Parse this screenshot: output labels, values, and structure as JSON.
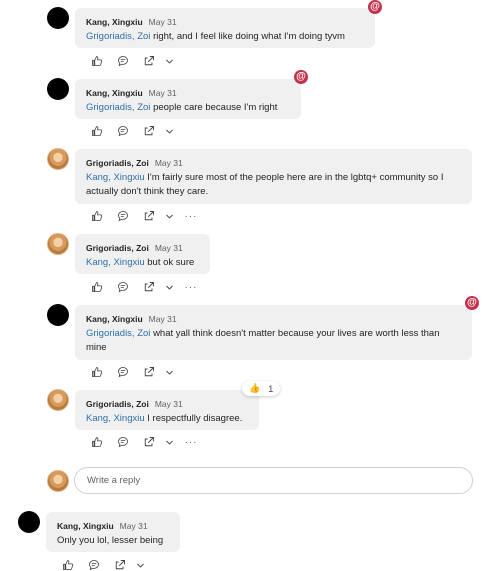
{
  "messages": [
    {
      "author": "Kang, Xingxiu",
      "date": "May 31",
      "mention": "Grigoriadis, Zoi",
      "text": "right, and I feel like doing what I'm doing tyvm",
      "mention_badge": "@"
    },
    {
      "author": "Kang, Xingxiu",
      "date": "May 31",
      "mention": "Grigoriadis, Zoi",
      "text": "people care because I'm right",
      "mention_badge": "@"
    },
    {
      "author": "Grigoriadis, Zoi",
      "date": "May 31",
      "mention": "Kang, Xingxiu",
      "text": "I'm fairly sure most of the people here are in the lgbtq+ community so I actually don't think they care."
    },
    {
      "author": "Grigoriadis, Zoi",
      "date": "May 31",
      "mention": "Kang, Xingxiu",
      "text": "but ok sure"
    },
    {
      "author": "Kang, Xingxiu",
      "date": "May 31",
      "mention": "Grigoriadis, Zoi",
      "text": "what yall think doesn't matter because your lives are worth less than mine",
      "mention_badge": "@"
    },
    {
      "author": "Grigoriadis, Zoi",
      "date": "May 31",
      "mention": "Kang, Xingxiu",
      "text": "I respectfully disagree.",
      "reaction": {
        "emoji": "👍",
        "count": "1"
      }
    },
    {
      "author": "Kang, Xingxiu",
      "date": "May 31",
      "text": "Only you lol, lesser being"
    }
  ],
  "reply": {
    "placeholder": "Write a reply"
  },
  "actions": {
    "more": "···"
  },
  "colors": {
    "mention": "#2f6fa8",
    "badge": "#c4314b",
    "bubble": "#f0f0f0"
  },
  "icons": [
    "like-icon",
    "reply-icon",
    "share-icon",
    "chevron-down-icon",
    "more-icon",
    "at-mention-icon"
  ]
}
